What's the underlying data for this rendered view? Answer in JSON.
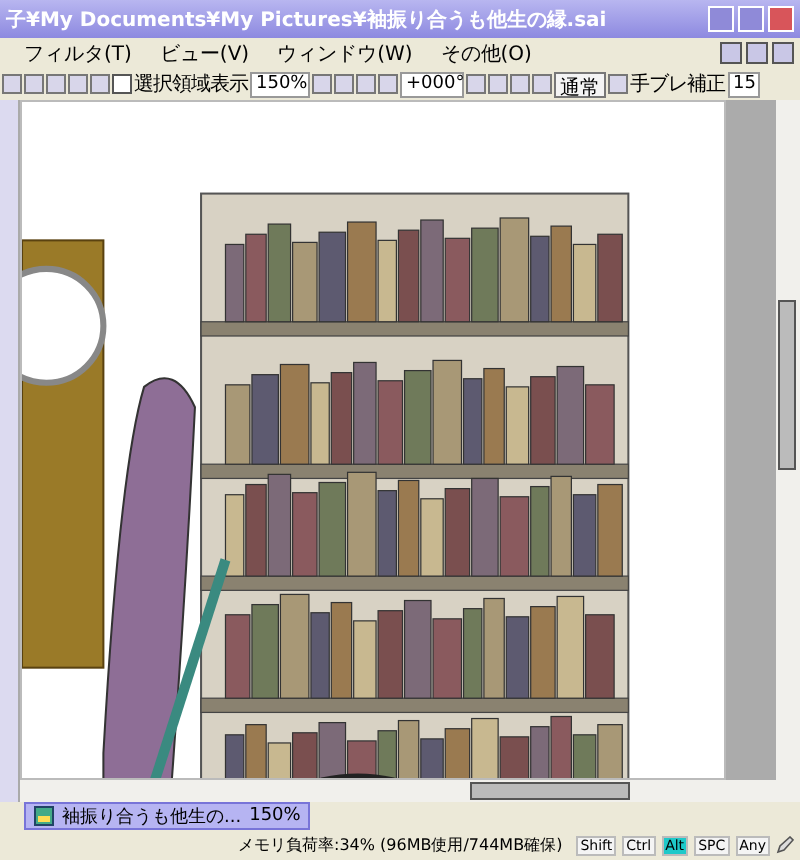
{
  "window": {
    "title": "子¥My Documents¥My Pictures¥袖振り合うも他生の縁.sai"
  },
  "menu": [
    "フィルタ(T)",
    "ビュー(V)",
    "ウィンドウ(W)",
    "その他(O)"
  ],
  "toolbar": {
    "selection_checkbox": {
      "label": "選択領域表示",
      "checked": false
    },
    "zoom": "150%",
    "angle": "+000°",
    "blend": "通常",
    "stabilizer_label": "手ブレ補正",
    "stabilizer": "15"
  },
  "document_tab": {
    "name": "袖振り合うも他生の...",
    "zoom": "150%",
    "selected": true
  },
  "status_bar": {
    "memory": "メモリ負荷率:34% (96MB使用/744MB確保)",
    "keys": [
      {
        "label": "Shift",
        "on": false
      },
      {
        "label": "Ctrl",
        "on": false
      },
      {
        "label": "Alt",
        "on": true
      },
      {
        "label": "SPC",
        "on": false
      },
      {
        "label": "Any",
        "on": false
      }
    ]
  }
}
